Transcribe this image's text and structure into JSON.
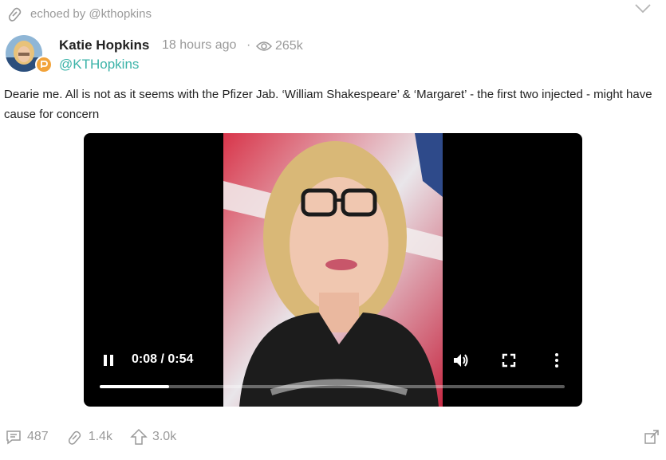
{
  "echo": {
    "label": "echoed by @kthopkins"
  },
  "author": {
    "name": "Katie Hopkins",
    "handle": "@KTHopkins",
    "time": "18 hours ago",
    "separator": "·",
    "views": "265k"
  },
  "post": {
    "text": "Dearie me. All is not as it seems with the Pfizer Jab. ‘William Shakespeare’ & ‘Margaret’ - the first two injected - might have cause for concern"
  },
  "video": {
    "time": "0:08 / 0:54",
    "progress_fraction": 0.15,
    "state": "playing"
  },
  "actions": {
    "comments": "487",
    "echoes": "1.4k",
    "upvotes": "3.0k"
  },
  "colors": {
    "handle": "#3bb3a8",
    "muted": "#9a9a9a",
    "badge": "#f2a33a"
  },
  "icons": [
    "echo-icon",
    "chevron-down-icon",
    "eye-icon",
    "pause-icon",
    "volume-icon",
    "fullscreen-icon",
    "more-vertical-icon",
    "comment-icon",
    "echo-icon",
    "upvote-icon",
    "expand-icon"
  ]
}
